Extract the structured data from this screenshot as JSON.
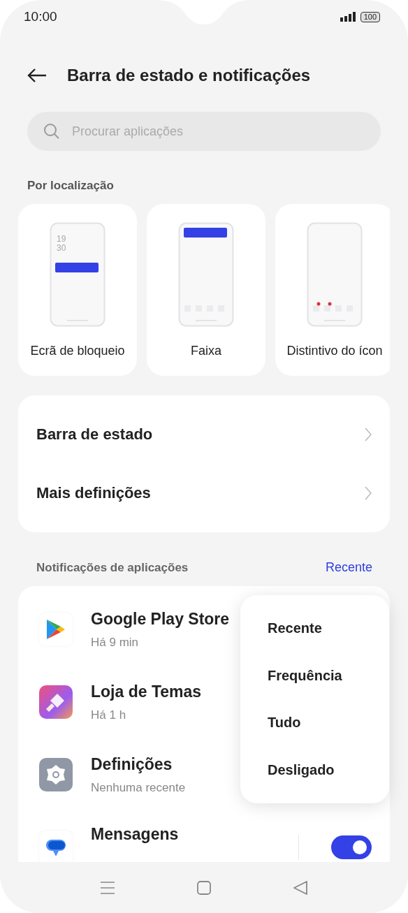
{
  "status_bar": {
    "time": "10:00",
    "battery": "100"
  },
  "header": {
    "title": "Barra de estado e notificações"
  },
  "search": {
    "placeholder": "Procurar aplicações"
  },
  "location_section": {
    "title": "Por localização",
    "cards": [
      {
        "kind": "lockscreen",
        "label": "Ecrã de bloqueio",
        "clock": [
          "19",
          "30"
        ]
      },
      {
        "kind": "banner",
        "label": "Faixa"
      },
      {
        "kind": "badge",
        "label": "Distintivo do ícon"
      }
    ]
  },
  "settings": [
    {
      "label": "Barra de estado"
    },
    {
      "label": "Mais definições"
    }
  ],
  "app_notifications": {
    "title": "Notificações de aplicações",
    "sort": "Recente",
    "apps": [
      {
        "kind": "play",
        "name": "Google Play Store",
        "time": "Há 9 min"
      },
      {
        "kind": "themes",
        "name": "Loja de Temas",
        "time": "Há 1 h"
      },
      {
        "kind": "settings",
        "name": "Definições",
        "time": "Nenhuma recente"
      },
      {
        "kind": "messages",
        "name": "Mensagens",
        "on": true
      }
    ]
  },
  "sort_menu": [
    {
      "label": "Recente"
    },
    {
      "label": "Frequência"
    },
    {
      "label": "Tudo"
    },
    {
      "label": "Desligado"
    }
  ]
}
